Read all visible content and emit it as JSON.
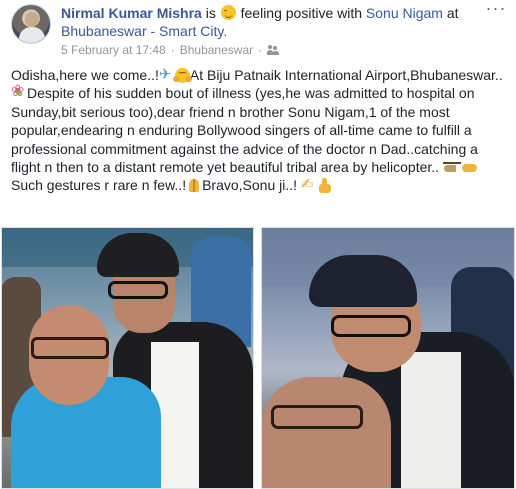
{
  "author": {
    "name": "Nirmal Kumar Mishra",
    "feeling_prefix": "is",
    "feeling": "feeling positive with",
    "tagged": "Sonu Nigam",
    "at_word": "at",
    "place": "Bhubaneswar - Smart City."
  },
  "meta": {
    "date": "5 February at 17:48",
    "separator": "·",
    "location": "Bhubaneswar",
    "separator2": "·",
    "audience_icon": "friends-icon"
  },
  "menu": {
    "more_label": "···"
  },
  "post": {
    "p1_a": "Odisha,here we come..!",
    "p1_b": "At Biju Patnaik International Airport,Bhubaneswar..",
    "p1_c": "Despite of his sudden bout of illness (yes,he was admitted to hospital on Sunday,bit serious too),dear friend n brother Sonu Nigam,1 of the most popular,endearing n enduring Bollywood singers of all-time came to fulfill a professional commitment against the advice of the doctor n Dad..catching a flight n then to a distant remote yet beautiful tribal area by helicopter..",
    "p2_a": "Such gestures r rare n few..!",
    "p2_b": "Bravo,Sonu ji..!"
  },
  "photos": [
    {
      "name": "photo-left",
      "subject": "selfie at airport"
    },
    {
      "name": "photo-right",
      "subject": "selfie at airport"
    }
  ],
  "colors": {
    "link": "#385898",
    "text": "#1d2129",
    "meta": "#90949c"
  }
}
